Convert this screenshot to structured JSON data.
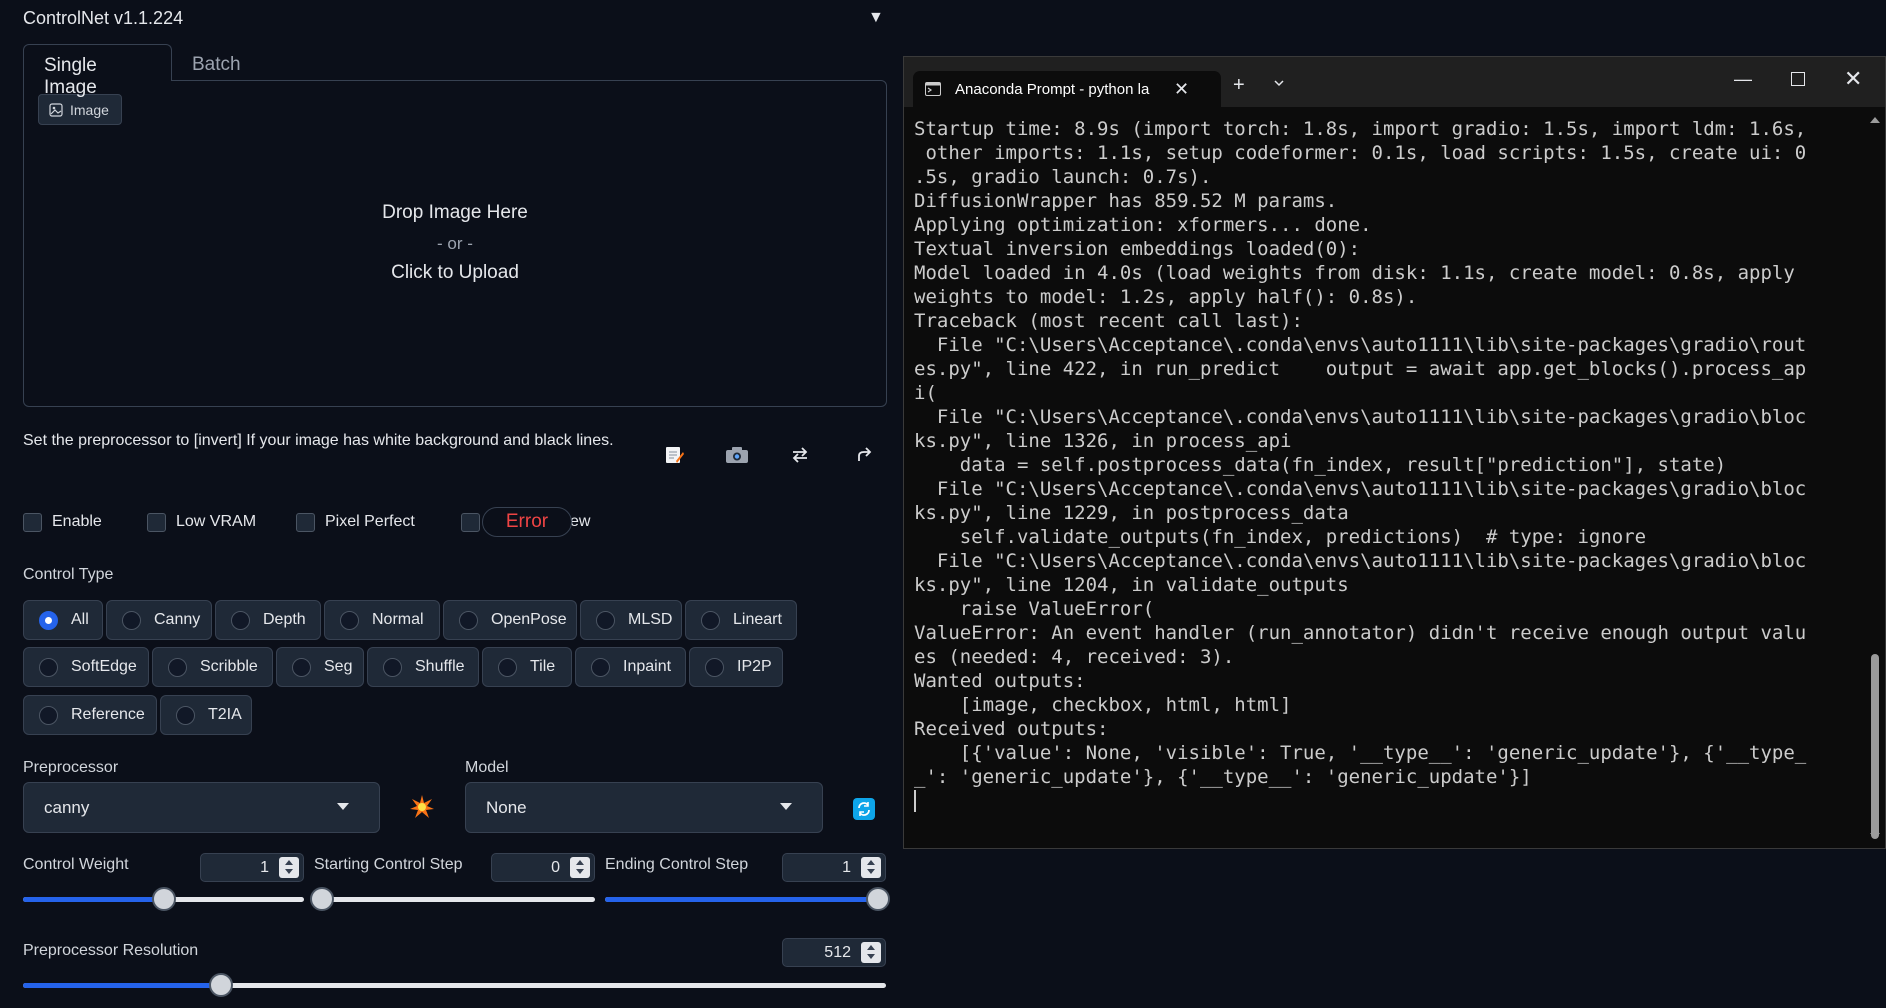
{
  "controlnet": {
    "title": "ControlNet v1.1.224",
    "collapse_icon": "triangle-down",
    "tabs": [
      "Single Image",
      "Batch"
    ],
    "image_label": "Image",
    "drop_text": "Drop Image Here",
    "or_text": "- or -",
    "click_text": "Click to Upload",
    "hint": "Set the preprocessor to [invert] If your image has white background and black lines.",
    "tool_icons": [
      "edit-icon",
      "camera-icon",
      "swap-icon",
      "send-icon"
    ],
    "checkboxes": [
      "Enable",
      "Low VRAM",
      "Pixel Perfect",
      "ew"
    ],
    "error_label": "Error",
    "control_type_label": "Control Type",
    "control_types_row1": [
      "All",
      "Canny",
      "Depth",
      "Normal",
      "OpenPose",
      "MLSD",
      "Lineart"
    ],
    "control_types_row2": [
      "SoftEdge",
      "Scribble",
      "Seg",
      "Shuffle",
      "Tile",
      "Inpaint",
      "IP2P"
    ],
    "control_types_row3": [
      "Reference",
      "T2IA"
    ],
    "selected_control_type": "All",
    "preprocessor_label": "Preprocessor",
    "preprocessor_value": "canny",
    "model_label": "Model",
    "model_value": "None",
    "control_weight_label": "Control Weight",
    "control_weight_value": "1",
    "start_step_label": "Starting Control Step",
    "start_step_value": "0",
    "end_step_label": "Ending Control Step",
    "end_step_value": "1",
    "resolution_label": "Preprocessor Resolution",
    "resolution_value": "512",
    "accent_color": "#2563eb",
    "error_color": "#ef4444"
  },
  "terminal": {
    "tab_title": "Anaconda Prompt - python la",
    "output": "Startup time: 8.9s (import torch: 1.8s, import gradio: 1.5s, import ldm: 1.6s,\n other imports: 1.1s, setup codeformer: 0.1s, load scripts: 1.5s, create ui: 0\n.5s, gradio launch: 0.7s).\nDiffusionWrapper has 859.52 M params.\nApplying optimization: xformers... done.\nTextual inversion embeddings loaded(0):\nModel loaded in 4.0s (load weights from disk: 1.1s, create model: 0.8s, apply\nweights to model: 1.2s, apply half(): 0.8s).\nTraceback (most recent call last):\n  File \"C:\\Users\\Acceptance\\.conda\\envs\\auto1111\\lib\\site-packages\\gradio\\rout\nes.py\", line 422, in run_predict    output = await app.get_blocks().process_ap\ni(\n  File \"C:\\Users\\Acceptance\\.conda\\envs\\auto1111\\lib\\site-packages\\gradio\\bloc\nks.py\", line 1326, in process_api\n    data = self.postprocess_data(fn_index, result[\"prediction\"], state)\n  File \"C:\\Users\\Acceptance\\.conda\\envs\\auto1111\\lib\\site-packages\\gradio\\bloc\nks.py\", line 1229, in postprocess_data\n    self.validate_outputs(fn_index, predictions)  # type: ignore\n  File \"C:\\Users\\Acceptance\\.conda\\envs\\auto1111\\lib\\site-packages\\gradio\\bloc\nks.py\", line 1204, in validate_outputs\n    raise ValueError(\nValueError: An event handler (run_annotator) didn't receive enough output valu\nes (needed: 4, received: 3).\nWanted outputs:\n    [image, checkbox, html, html]\nReceived outputs:\n    [{'value': None, 'visible': True, '__type__': 'generic_update'}, {'__type_\n_': 'generic_update'}, {'__type__': 'generic_update'}]"
  },
  "sliders": {
    "control_weight_fraction": 0.5,
    "start_step_fraction": 0.0,
    "end_step_fraction": 1.0,
    "resolution_fraction": 0.23
  }
}
